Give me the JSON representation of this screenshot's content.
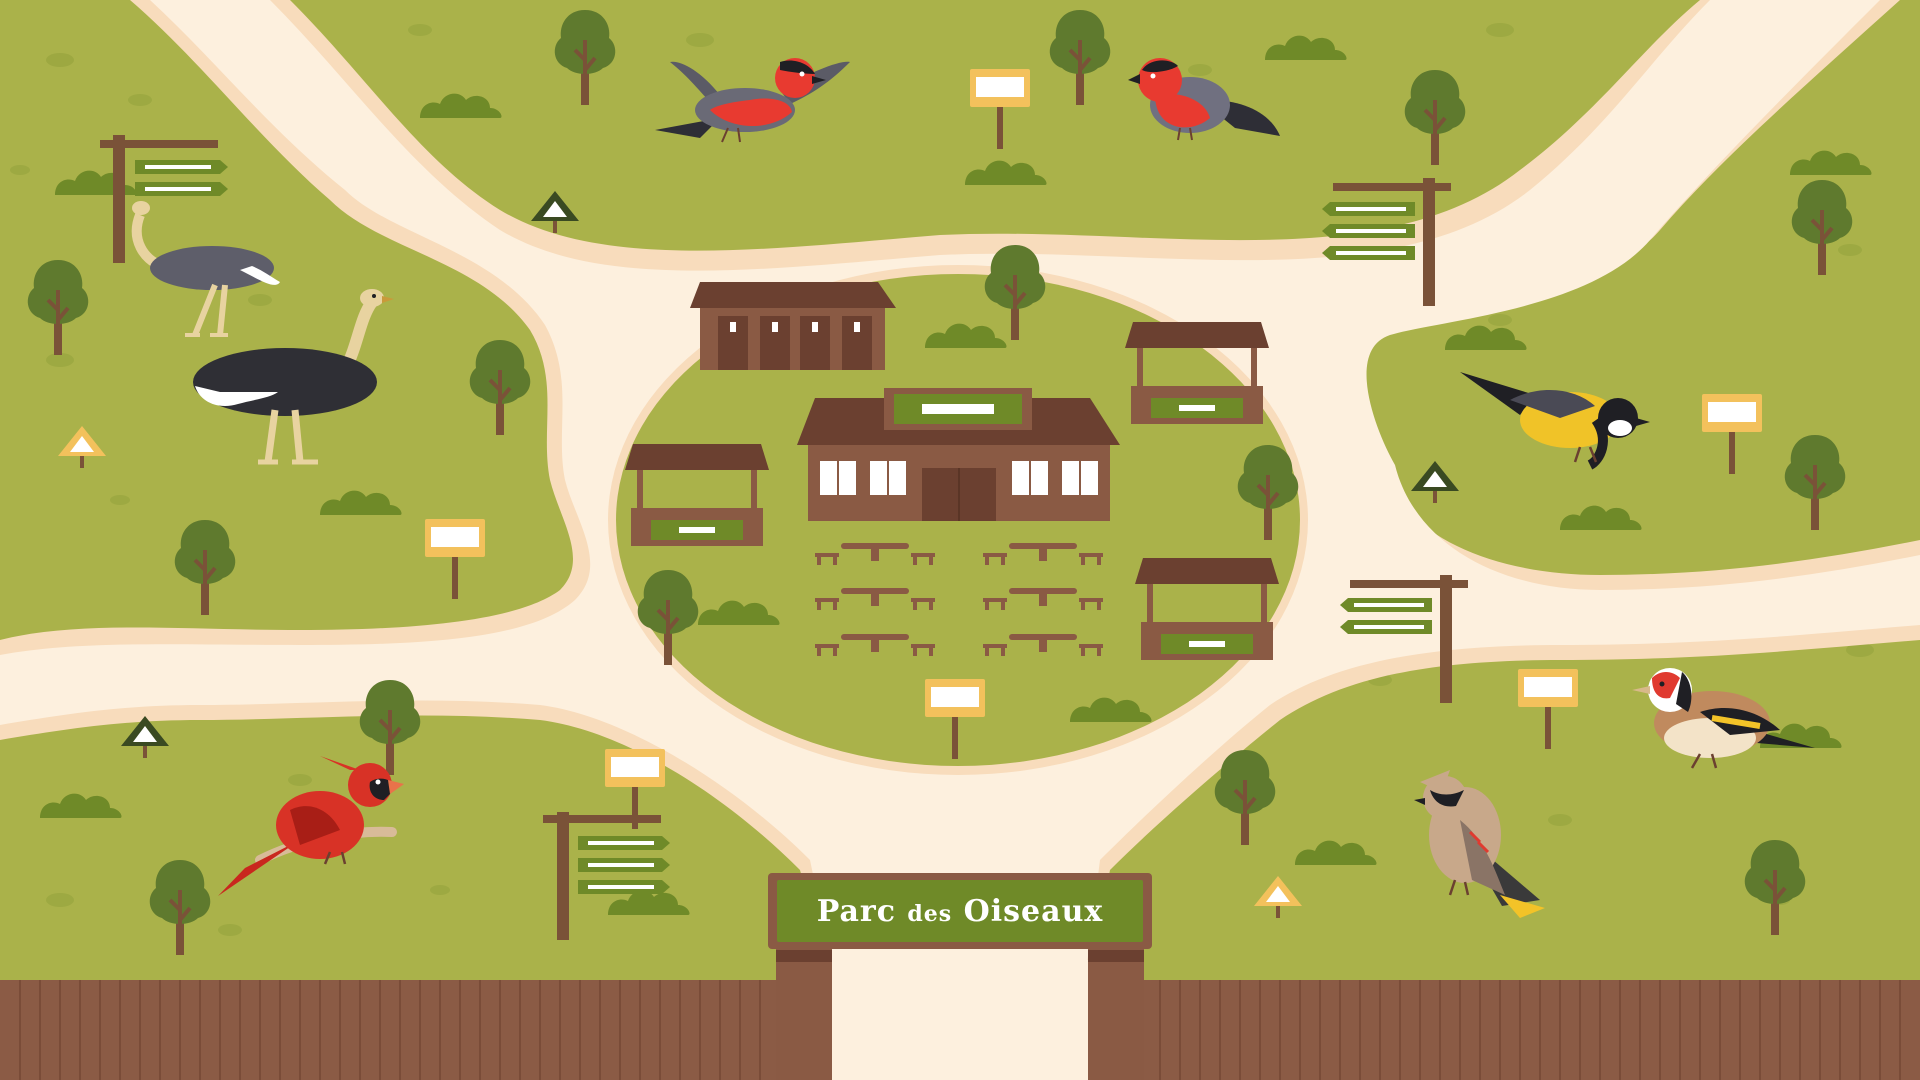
{
  "park": {
    "name_part1": "Parc",
    "name_part2": "des",
    "name_part3": "Oiseaux"
  },
  "colors": {
    "grass": "#aab24a",
    "grass_light": "#a3b046",
    "path": "#fdf0de",
    "path_edge": "#f8dcbc",
    "wood": "#8a5a44",
    "wood_dark": "#6b4030",
    "fence": "#8b5b45",
    "tree": "#5f7a2e",
    "trunk": "#7a5238",
    "sign_yellow": "#f3c15c",
    "sign_green": "#6f8a28"
  },
  "birds": [
    {
      "name": "bullfinch-flying-icon"
    },
    {
      "name": "bullfinch-perched-icon"
    },
    {
      "name": "ostrich-grazing-icon"
    },
    {
      "name": "ostrich-standing-icon"
    },
    {
      "name": "great-tit-icon"
    },
    {
      "name": "goldfinch-icon"
    },
    {
      "name": "waxwing-icon"
    },
    {
      "name": "cardinal-icon"
    }
  ],
  "facilities": [
    {
      "name": "toilets-building"
    },
    {
      "name": "main-visitor-center"
    },
    {
      "name": "kiosk-left"
    },
    {
      "name": "kiosk-top-right"
    },
    {
      "name": "kiosk-bottom-right"
    },
    {
      "name": "picnic-area"
    }
  ]
}
